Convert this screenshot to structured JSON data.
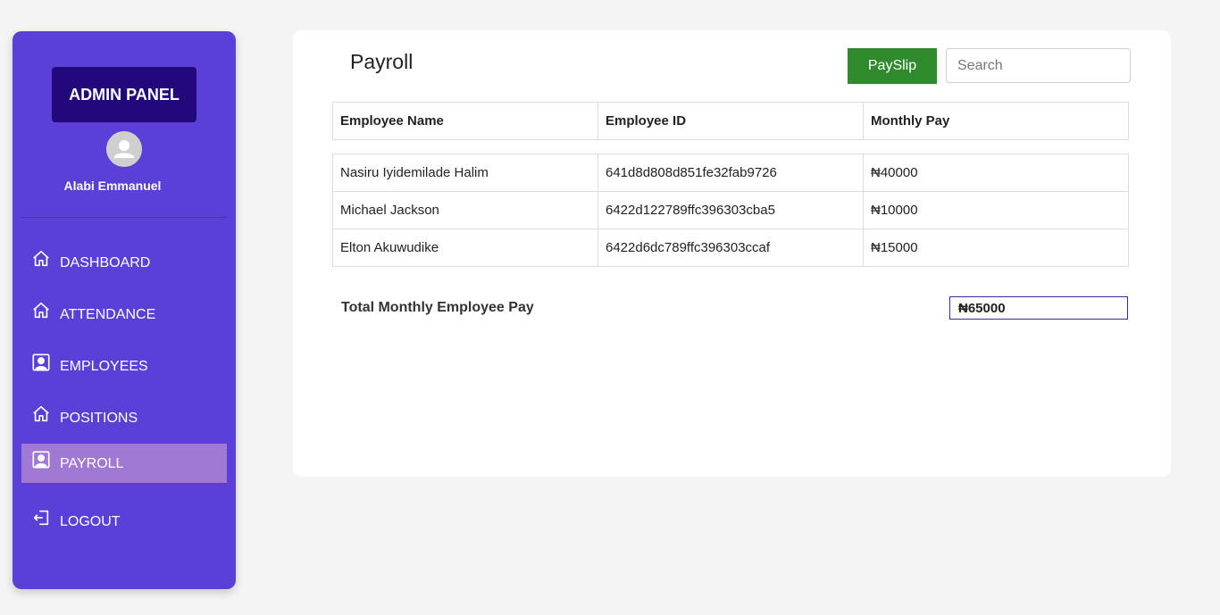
{
  "sidebar": {
    "brand": "ADMIN PANEL",
    "user_name": "Alabi Emmanuel",
    "items": [
      {
        "label": "DASHBOARD",
        "icon": "home-icon"
      },
      {
        "label": "ATTENDANCE",
        "icon": "home-icon"
      },
      {
        "label": "EMPLOYEES",
        "icon": "user-portrait-icon"
      },
      {
        "label": "POSITIONS",
        "icon": "home-icon"
      },
      {
        "label": "PAYROLL",
        "icon": "user-portrait-icon",
        "active": true
      },
      {
        "label": "LOGOUT",
        "icon": "logout-icon"
      }
    ],
    "colors": {
      "background": "#5b3fd6",
      "brand_bg": "#22087a",
      "active_bg": "#a178d4"
    }
  },
  "main": {
    "title": "Payroll",
    "payslip_label": "PaySlip",
    "search_placeholder": "Search",
    "table": {
      "headers": [
        "Employee Name",
        "Employee ID",
        "Monthly Pay"
      ],
      "rows": [
        [
          "Nasiru Iyidemilade Halim",
          "641d8d808d851fe32fab9726",
          "₦40000"
        ],
        [
          "Michael Jackson",
          "6422d122789ffc396303cba5",
          "₦10000"
        ],
        [
          "Elton Akuwudike",
          "6422d6dc789ffc396303ccaf",
          "₦15000"
        ]
      ]
    },
    "total_label": "Total Monthly Employee Pay",
    "total_value": "₦65000",
    "colors": {
      "payslip_button": "#2f8a2d"
    }
  }
}
